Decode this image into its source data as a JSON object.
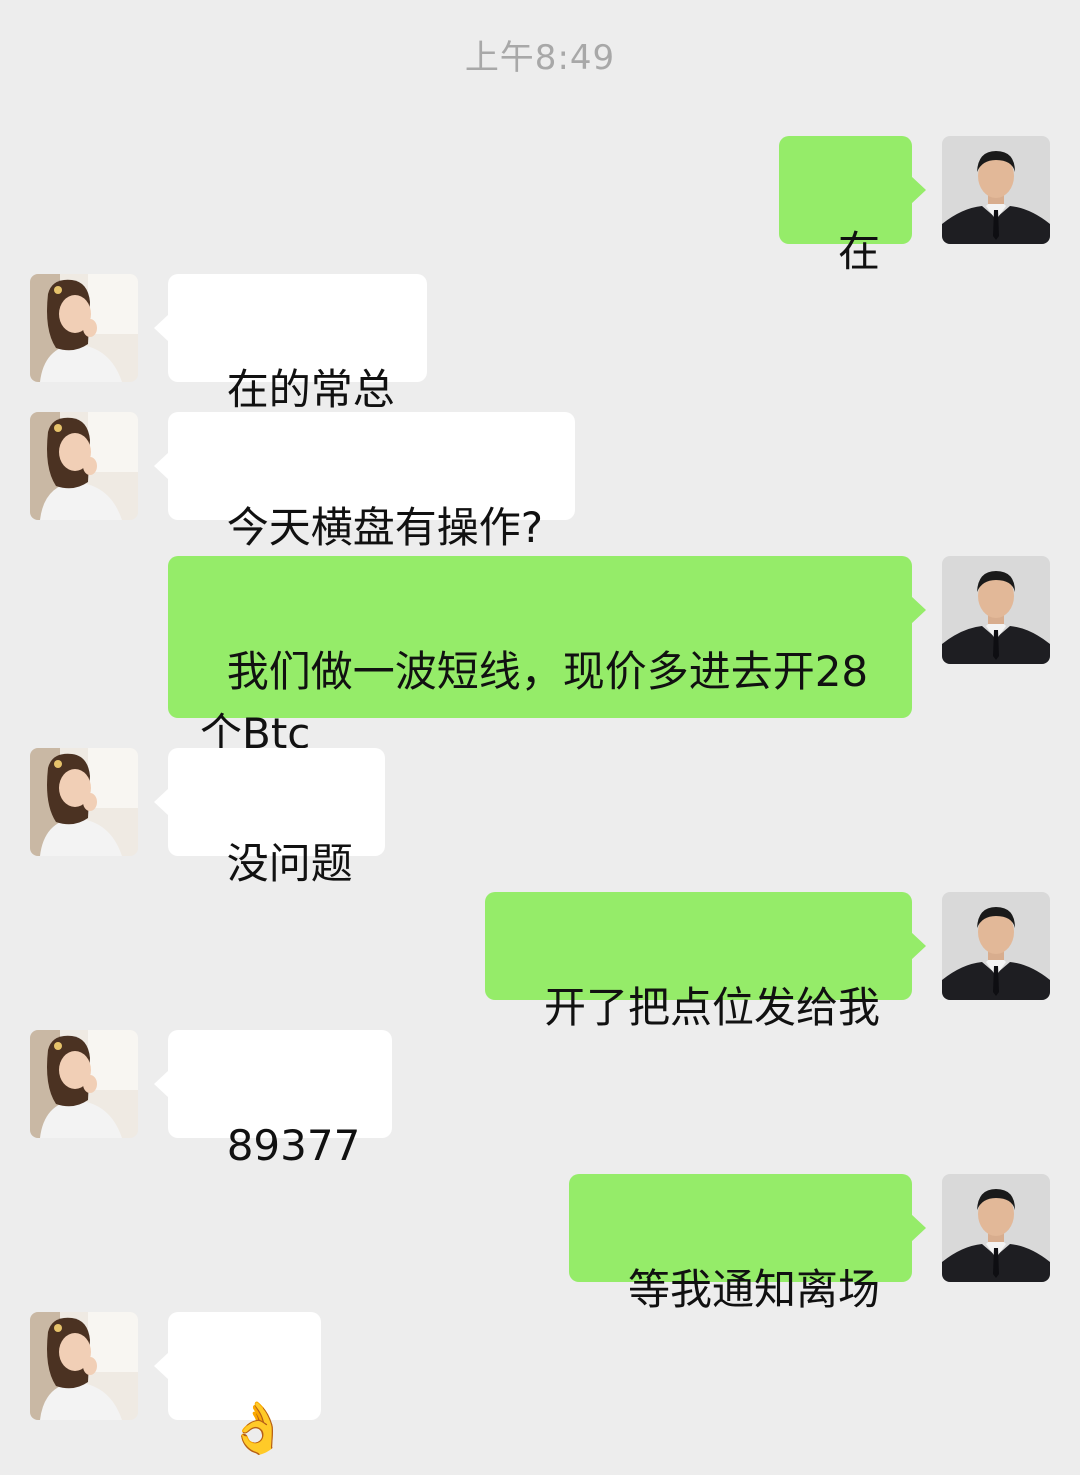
{
  "timestamp": "上午8:49",
  "contacts": {
    "self": {
      "avatar": "man-in-suit-avatar"
    },
    "other": {
      "avatar": "girl-avatar"
    }
  },
  "messages": [
    {
      "from": "self",
      "text": "在"
    },
    {
      "from": "other",
      "text": "在的常总"
    },
    {
      "from": "other",
      "text": "今天横盘有操作?"
    },
    {
      "from": "self",
      "text": "我们做一波短线，现价多进去开28\n个Btc"
    },
    {
      "from": "other",
      "text": "没问题"
    },
    {
      "from": "self",
      "text": "开了把点位发给我"
    },
    {
      "from": "other",
      "text": "89377"
    },
    {
      "from": "self",
      "text": "等我通知离场"
    },
    {
      "from": "other",
      "text": "👌"
    }
  ],
  "colors": {
    "background": "#ededed",
    "outgoing_bubble": "#95ec69",
    "incoming_bubble": "#ffffff",
    "timestamp_text": "#a8a8a8"
  }
}
